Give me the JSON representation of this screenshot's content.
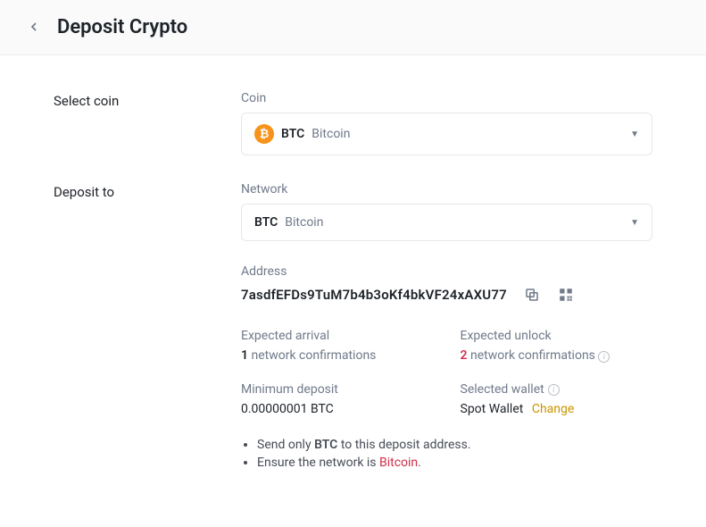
{
  "header": {
    "title": "Deposit Crypto"
  },
  "select_coin": {
    "row_label": "Select coin",
    "field_label": "Coin",
    "symbol": "BTC",
    "name": "Bitcoin",
    "icon_glyph": "₿"
  },
  "deposit_to": {
    "row_label": "Deposit to",
    "network_label": "Network",
    "network_symbol": "BTC",
    "network_name": "Bitcoin",
    "address_label": "Address",
    "address": "7asdfEFDs9TuM7b4b3oKf4bkVF24xAXU77"
  },
  "info": {
    "expected_arrival": {
      "label": "Expected arrival",
      "count": "1",
      "suffix": "network confirmations"
    },
    "expected_unlock": {
      "label": "Expected unlock",
      "count": "2",
      "suffix": "network confirmations"
    },
    "minimum_deposit": {
      "label": "Minimum deposit",
      "value": "0.00000001 BTC"
    },
    "selected_wallet": {
      "label": "Selected wallet",
      "value": "Spot Wallet",
      "change": "Change"
    }
  },
  "notes": {
    "line1_pre": "Send only ",
    "line1_strong": "BTC",
    "line1_post": " to this deposit address.",
    "line2_pre": "Ensure the network is ",
    "line2_red": "Bitcoin",
    "line2_post": "."
  }
}
